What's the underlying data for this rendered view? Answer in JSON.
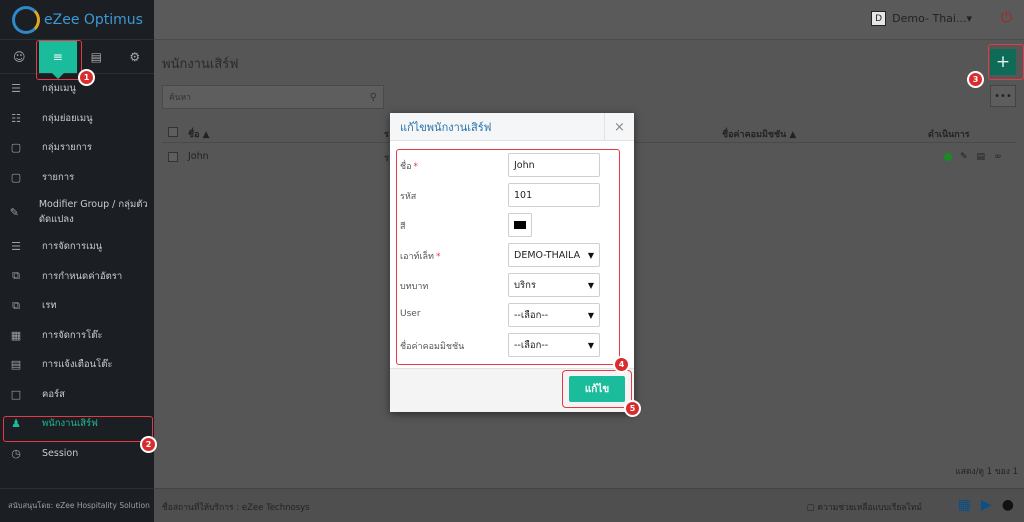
{
  "brand": {
    "name": "eZee Optimus"
  },
  "sidebar": {
    "tabs": [
      {
        "icon": "user-icon"
      },
      {
        "icon": "list-icon"
      },
      {
        "icon": "cart-icon"
      },
      {
        "icon": "gear-icon"
      }
    ],
    "items": [
      {
        "label": "กลุ่มเมนู",
        "icon": "list-icon"
      },
      {
        "label": "กลุ่มย่อยเมนู",
        "icon": "sub-list-icon"
      },
      {
        "label": "กลุ่มรายการ",
        "icon": "cube-icon"
      },
      {
        "label": "รายการ",
        "icon": "cube-icon"
      },
      {
        "label": "Modifier Group / กลุ่มตัวดัดแปลง",
        "icon": "edit-icon"
      },
      {
        "label": "การจัดการเมนู",
        "icon": "menu-icon"
      },
      {
        "label": "การกำหนดค่าอัตรา",
        "icon": "copy-icon"
      },
      {
        "label": "เรท",
        "icon": "copy-icon"
      },
      {
        "label": "การจัดการโต๊ะ",
        "icon": "grid-icon"
      },
      {
        "label": "การแจ้งเตือนโต๊ะ",
        "icon": "message-icon"
      },
      {
        "label": "คอร์ส",
        "icon": "bookmark-icon"
      },
      {
        "label": "พนักงานเสิร์ฟ",
        "icon": "person-icon"
      },
      {
        "label": "Session",
        "icon": "clock-icon"
      }
    ],
    "footer": "สนับสนุนโดย: eZee Hospitality Solution"
  },
  "topbar": {
    "property_badge": "D",
    "property_name": "Demo- Thai...▾"
  },
  "page": {
    "title": "พนักงานเสิร์ฟ",
    "add_label": "+",
    "more_label": "•••",
    "search_placeholder": "ค้นหา",
    "columns": {
      "name": "ชื่อ ▲",
      "code": "ร",
      "commission": "ชื่อค่าคอมมิชชัน ▲",
      "actions": "ดำเนินการ"
    },
    "rows": [
      {
        "name": "John",
        "code": "ร"
      }
    ],
    "pager": "แสดง/ดู 1 ของ 1"
  },
  "footer": {
    "provider": "ชื่อสถานที่ให้บริการ : eZee Technosys",
    "help": "ความช่วยเหลือแบบเรียลไทม์"
  },
  "modal": {
    "title": "แก้ไขพนักงานเสิร์ฟ",
    "close": "×",
    "fields": {
      "name_label": "ชื่อ",
      "name_value": "John",
      "code_label": "รหัส",
      "code_value": "101",
      "color_label": "สี",
      "color_value": "#000000",
      "outlet_label": "เอาท์เล็ท",
      "outlet_value": "DEMO-THAILA",
      "role_label": "บทบาท",
      "role_value": "บริกร",
      "user_label": "User",
      "user_value": "--เลือก--",
      "commission_label": "ชื่อค่าคอมมิชชัน",
      "commission_value": "--เลือก--"
    },
    "required_mark": "*",
    "save_label": "แก้ไข"
  },
  "annotations": [
    "1",
    "2",
    "3",
    "4",
    "5"
  ],
  "colors": {
    "accent": "#1abc9c",
    "highlight": "#e63946",
    "sidebar": "#1b1e22"
  }
}
